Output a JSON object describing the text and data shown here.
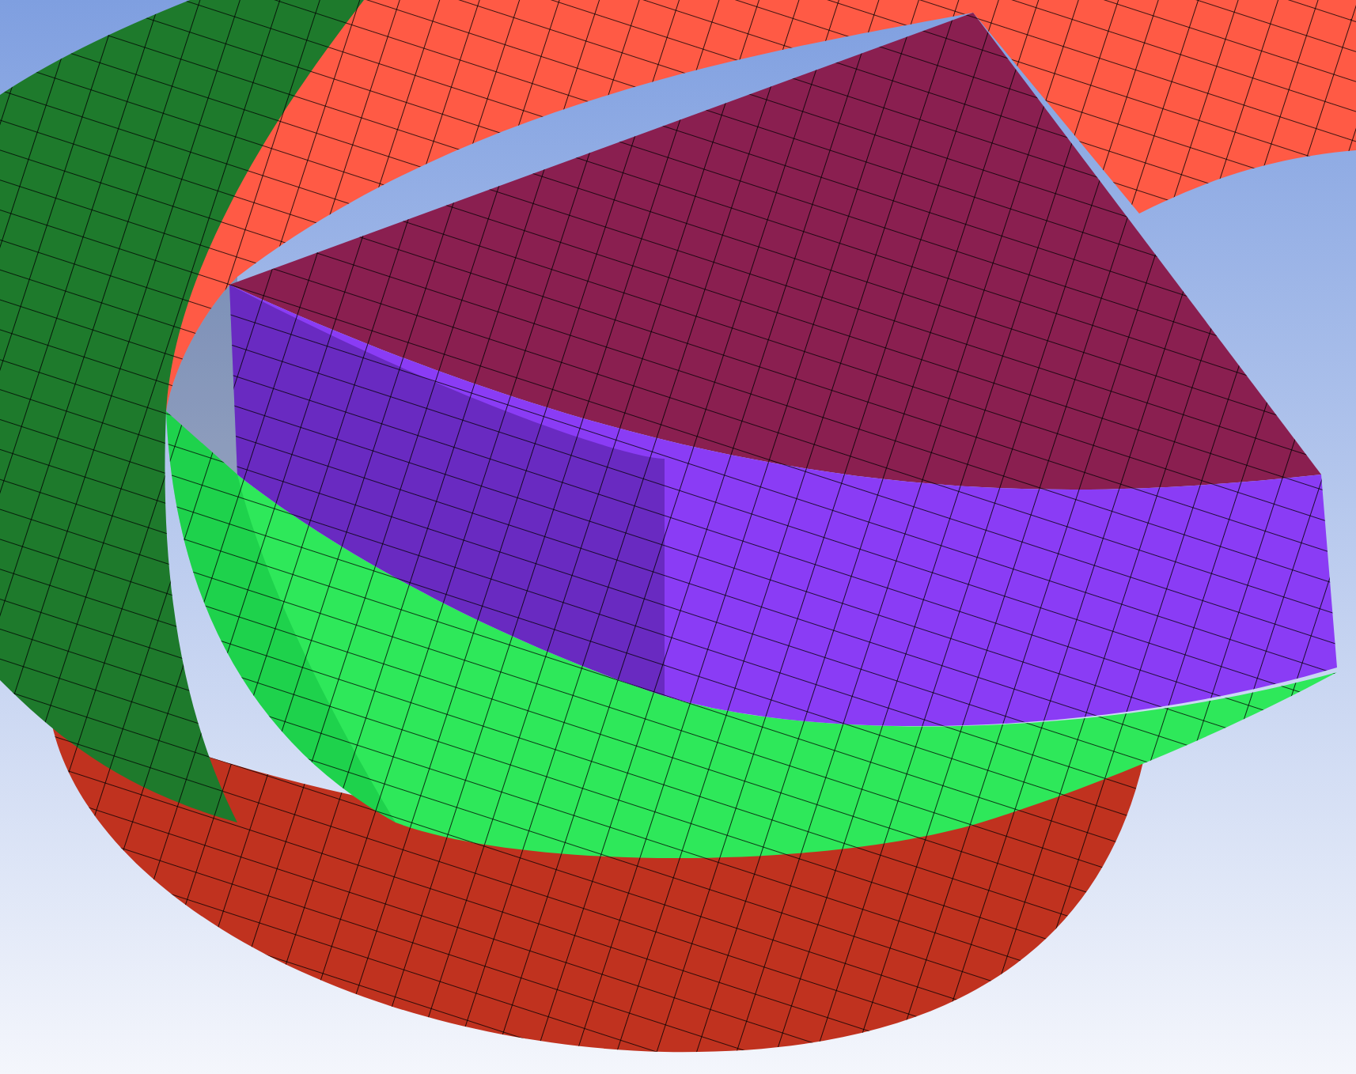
{
  "scene": {
    "parts": [
      {
        "kind": "bowl",
        "color": "#c0321f"
      },
      {
        "kind": "ring",
        "color": "#ff5a45"
      },
      {
        "kind": "band",
        "color": "#2ee85a"
      },
      {
        "kind": "block",
        "color": "#8a3cf5"
      }
    ]
  }
}
